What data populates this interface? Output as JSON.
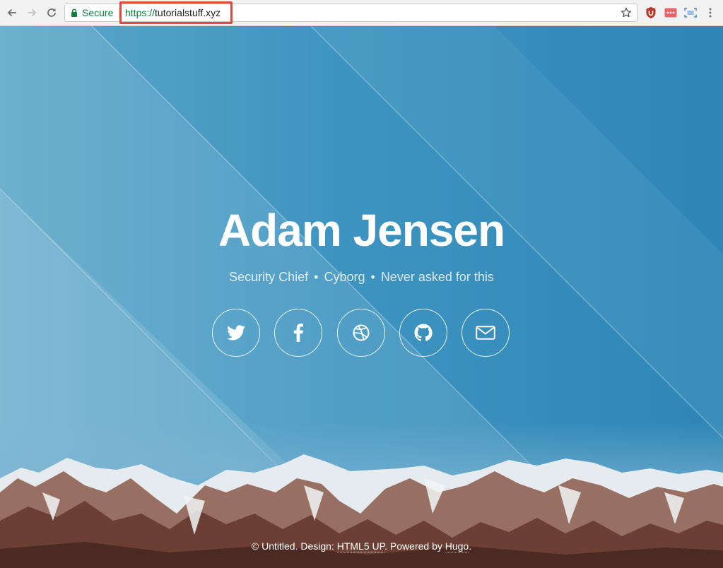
{
  "browser": {
    "secure_label": "Secure",
    "url_scheme": "https://",
    "url_host": "tutorialstuff.xyz"
  },
  "page": {
    "name": "Adam Jensen",
    "tagline": [
      "Security Chief",
      "Cyborg",
      "Never asked for this"
    ],
    "separator": "•",
    "socials": [
      {
        "icon": "twitter-icon"
      },
      {
        "icon": "facebook-icon"
      },
      {
        "icon": "dribbble-icon"
      },
      {
        "icon": "github-icon"
      },
      {
        "icon": "envelope-icon"
      }
    ],
    "footer": {
      "prefix": "© Untitled. Design: ",
      "design_link": "HTML5 UP",
      "middle": ". Powered by ",
      "powered_link": "Hugo",
      "suffix": "."
    }
  },
  "colors": {
    "secure_green": "#0b8043",
    "highlight_red": "#e04a3b",
    "sky_blue": "#2f89b8"
  }
}
